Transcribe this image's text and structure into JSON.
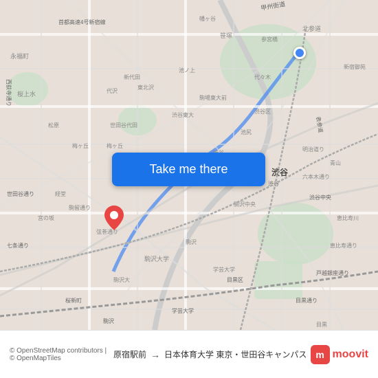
{
  "map": {
    "background_color": "#e8e0d8",
    "origin_label": "原宿駅前",
    "destination_label": "日本体育大学 東京・世田谷キャンパス",
    "button_label": "Take me there"
  },
  "bottom_bar": {
    "copyright": "© OpenStreetMap contributors | © OpenMapTiles",
    "origin": "原宿駅前",
    "destination": "日本体育大学 東京・世田谷キャンパス",
    "app_name": "moovit"
  },
  "icons": {
    "pin": "📍",
    "arrow": "→"
  }
}
